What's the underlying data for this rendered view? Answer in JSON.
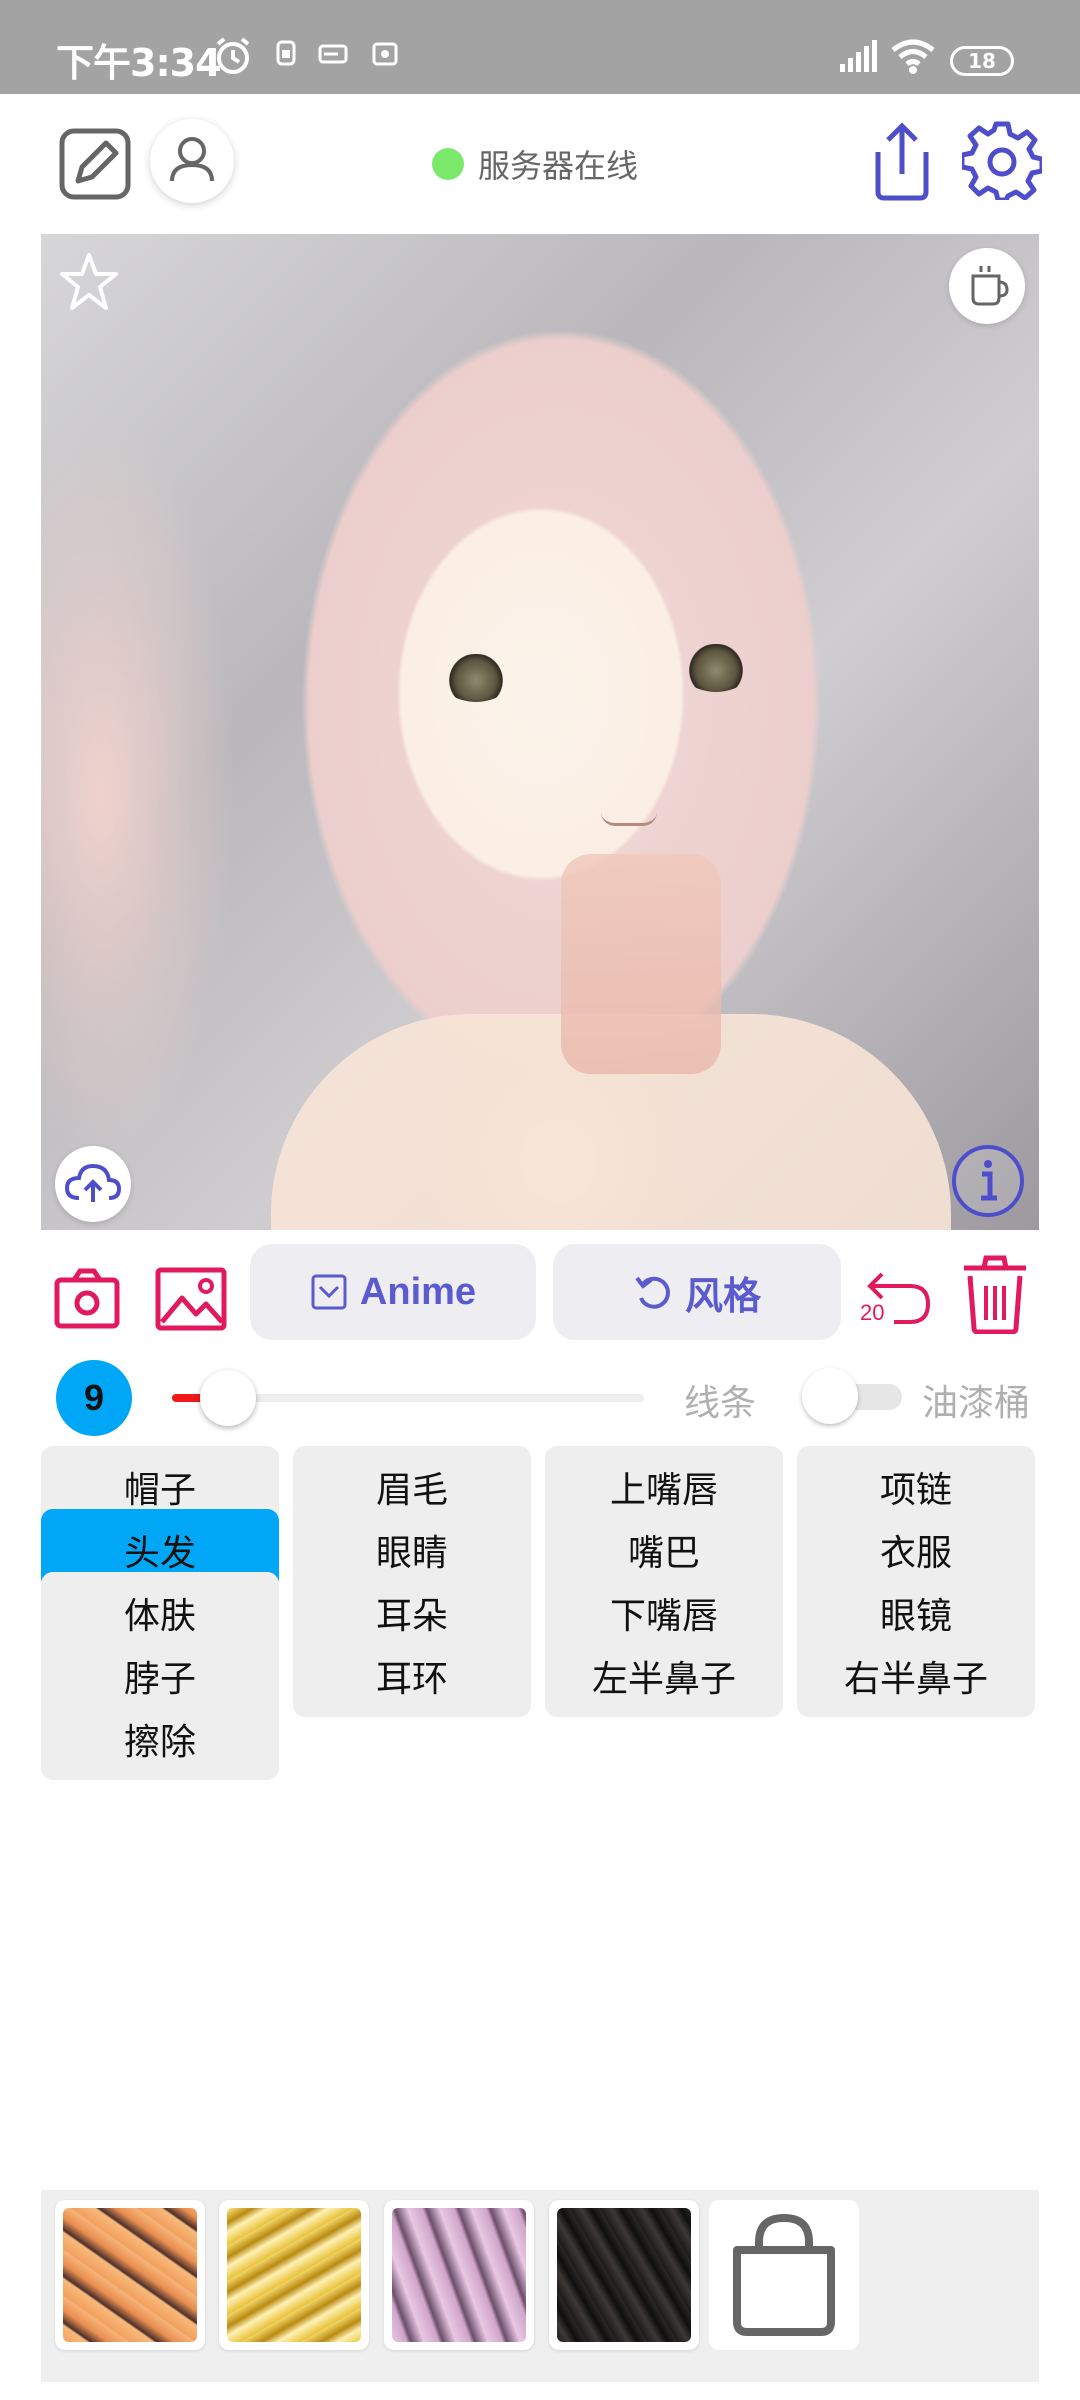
{
  "status_bar": {
    "time": "下午3:34",
    "battery": "18"
  },
  "header": {
    "server_status": "服务器在线",
    "colors": {
      "online": "#7bea6c",
      "accent": "#5b5bcf"
    }
  },
  "toolbar": {
    "anime_label": "Anime",
    "style_label": "风格",
    "undo_count": "20",
    "colors": {
      "action": "#e21a5b",
      "pill_text": "#5b5bcf",
      "pill_bg": "#eeeef2"
    }
  },
  "brush": {
    "size": "9",
    "size_slider_fraction": 0.08,
    "lines_label": "线条",
    "bucket_label": "油漆桶",
    "bucket_enabled": false,
    "colors": {
      "size_badge": "#00a7f7",
      "slider_fill": "#f01818"
    }
  },
  "parts": [
    "帽子",
    "眉毛",
    "上嘴唇",
    "项链",
    "头发",
    "眼睛",
    "嘴巴",
    "衣服",
    "体肤",
    "耳朵",
    "下嘴唇",
    "眼镜",
    "脖子",
    "耳环",
    "左半鼻子",
    "右半鼻子",
    "擦除"
  ],
  "selected_part": "头发",
  "styles_tray": {
    "swatches": [
      "orange-texture",
      "gold-texture",
      "pink-texture",
      "dark-texture"
    ],
    "more_icon": "shopping-bag-icon"
  }
}
